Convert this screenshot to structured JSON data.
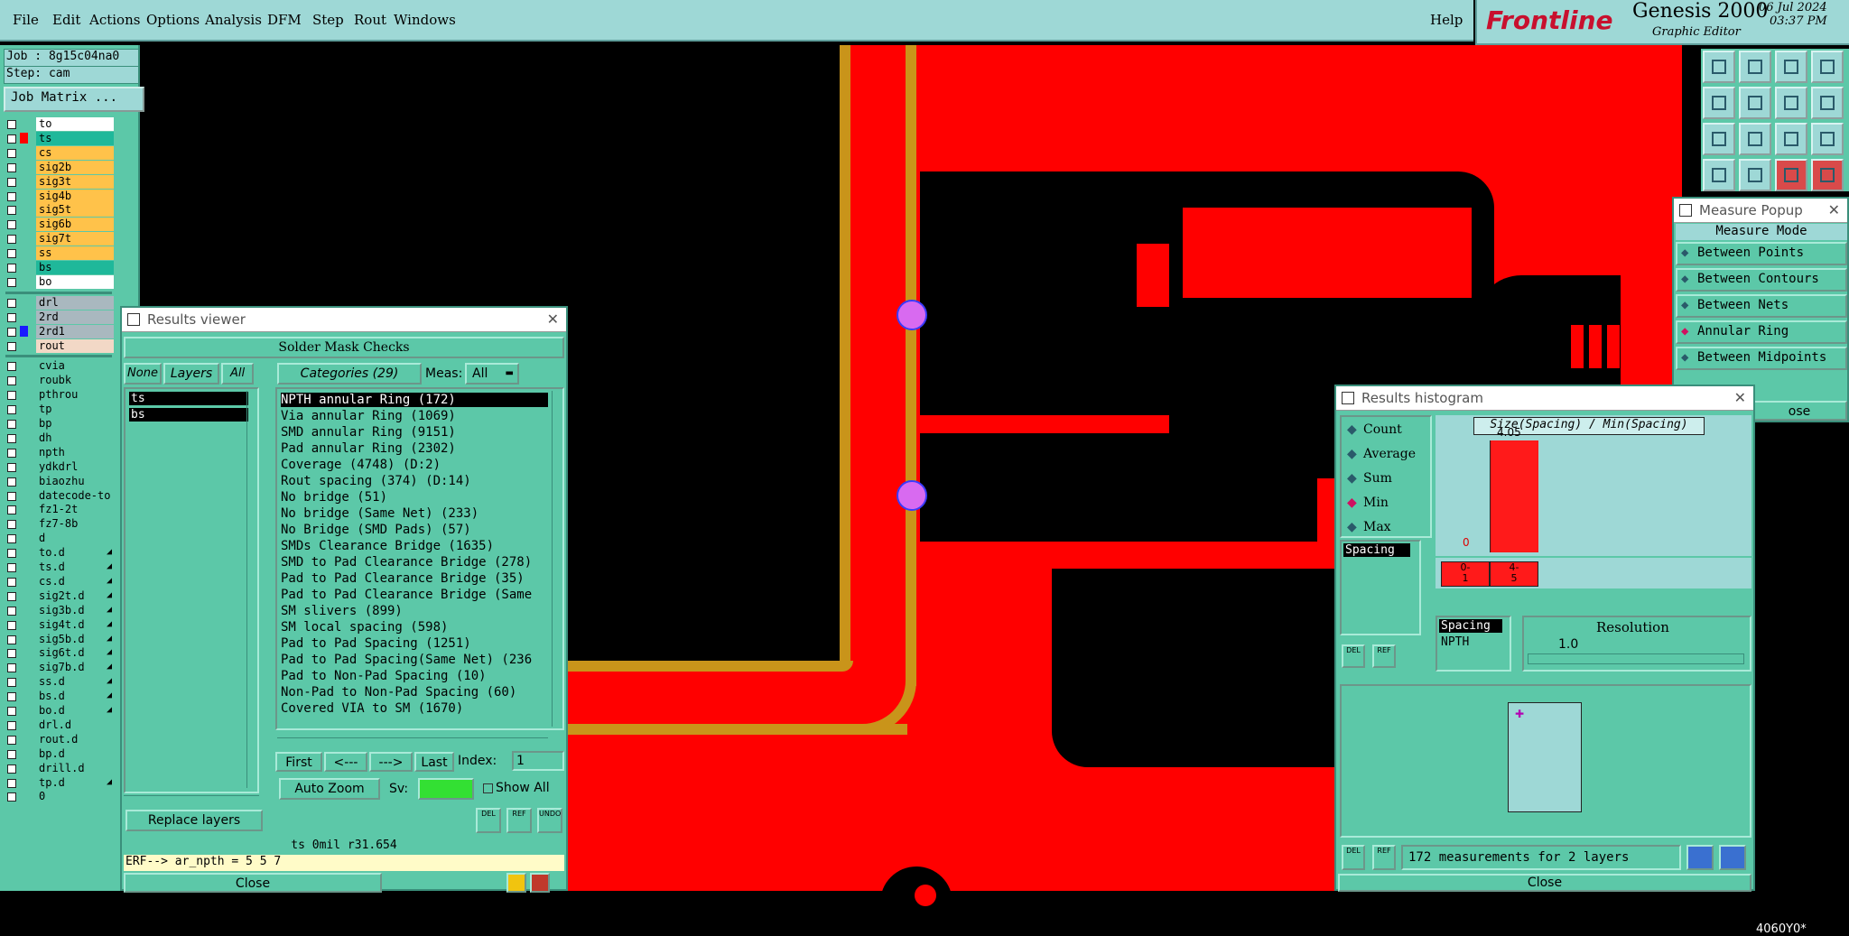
{
  "menu": [
    "File",
    "Edit",
    "Actions",
    "Options",
    "Analysis",
    "DFM",
    "Step",
    "Rout",
    "Windows"
  ],
  "help": "Help",
  "brand": {
    "logo": "Frontline",
    "product": "Genesis 2000",
    "subtitle": "Graphic Editor",
    "date": "06 Jul 2024",
    "time": "03:37 PM"
  },
  "job": {
    "job_line": "Job : 8g15c04na0",
    "step_line": "Step: cam",
    "matrix_button": "Job Matrix ..."
  },
  "layers_group1": [
    {
      "name": "to",
      "color": "#ffffff",
      "swatch": ""
    },
    {
      "name": "ts",
      "color": "#1fb89a",
      "swatch": "#ff0000"
    },
    {
      "name": "cs",
      "color": "#ffc24a",
      "swatch": ""
    },
    {
      "name": "sig2b",
      "color": "#ffc24a",
      "swatch": ""
    },
    {
      "name": "sig3t",
      "color": "#ffc24a",
      "swatch": ""
    },
    {
      "name": "sig4b",
      "color": "#ffc24a",
      "swatch": ""
    },
    {
      "name": "sig5t",
      "color": "#ffc24a",
      "swatch": ""
    },
    {
      "name": "sig6b",
      "color": "#ffc24a",
      "swatch": ""
    },
    {
      "name": "sig7t",
      "color": "#ffc24a",
      "swatch": ""
    },
    {
      "name": "ss",
      "color": "#ffc24a",
      "swatch": ""
    },
    {
      "name": "bs",
      "color": "#1fb89a",
      "swatch": ""
    },
    {
      "name": "bo",
      "color": "#ffffff",
      "swatch": ""
    }
  ],
  "layers_group2": [
    {
      "name": "drl",
      "color": "#a9b8bf",
      "swatch": ""
    },
    {
      "name": "2rd",
      "color": "#a9b8bf",
      "swatch": ""
    },
    {
      "name": "2rd1",
      "color": "#a9b8bf",
      "swatch": "#1a1aff"
    },
    {
      "name": "rout",
      "color": "#f2d8c6",
      "swatch": ""
    }
  ],
  "layers_group3": [
    "cvia",
    "roubk",
    "pthrou",
    "tp",
    "bp",
    "dh",
    "npth",
    "ydkdrl",
    "biaozhu",
    "datecode-to",
    "fz1-2t",
    "fz7-8b",
    "d",
    "to.d",
    "ts.d",
    "cs.d",
    "sig2t.d",
    "sig3b.d",
    "sig4t.d",
    "sig5b.d",
    "sig6t.d",
    "sig7b.d",
    "ss.d",
    "bs.d",
    "bo.d",
    "drl.d",
    "rout.d",
    "bp.d",
    "drill.d",
    "tp.d",
    "0"
  ],
  "results_viewer": {
    "title": "Results viewer",
    "header": "Solder Mask Checks",
    "btn_none": "None",
    "btn_layers": "Layers",
    "btn_all": "All",
    "categories_label": "Categories (29)",
    "meas_label": "Meas:",
    "meas_value": "All",
    "layers": [
      "ts",
      "bs"
    ],
    "categories": [
      "NPTH annular Ring (172)",
      "Via annular Ring (1069)",
      "SMD annular Ring (9151)",
      "Pad annular Ring (2302)",
      "Coverage (4748)          (D:2)",
      "Rout spacing (374)       (D:14)",
      "No bridge (51)",
      "No bridge (Same Net) (233)",
      "No Bridge (SMD Pads) (57)",
      "SMDs Clearance Bridge (1635)",
      "SMD to Pad Clearance Bridge (278)",
      "Pad to Pad Clearance Bridge (35)",
      "Pad to Pad Clearance Bridge (Same",
      "SM slivers (899)",
      "SM local spacing (598)",
      "Pad to Pad Spacing (1251)",
      "Pad to Pad Spacing(Same Net) (236",
      "Pad to Non-Pad Spacing (10)",
      "Non-Pad to Non-Pad Spacing (60)",
      "Covered VIA to SM (1670)"
    ],
    "nav_first": "First",
    "nav_prev": "<---",
    "nav_next": "--->",
    "nav_last": "Last",
    "index_label": "Index:",
    "index_value": "1",
    "auto_zoom": "Auto Zoom",
    "sv_label": "Sv:",
    "show_all": "Show All",
    "replace_layers": "Replace layers",
    "btn_del": "DEL",
    "btn_ref": "REF",
    "btn_undo": "UNDO",
    "status": "ts 0mil  r31.654",
    "erf": "ERF--> ar_npth = 5 5 7",
    "close": "Close"
  },
  "measure_popup": {
    "title": "Measure Popup",
    "mode_label": "Measure Mode",
    "modes": [
      "Between Points",
      "Between Contours",
      "Between Nets",
      "Annular Ring",
      "Between Midpoints"
    ],
    "selected": "Annular Ring",
    "close_partial": "ose"
  },
  "histogram": {
    "title": "Results histogram",
    "stats": [
      "Count",
      "Average",
      "Sum",
      "Min",
      "Max"
    ],
    "selected_stat": "Min",
    "chart_title": "Size(Spacing) / Min(Spacing)",
    "max_label": "4.05",
    "zero_label": "0",
    "bins": [
      "0-\n1",
      "4-\n5"
    ],
    "list_items": [
      "Spacing"
    ],
    "lower_list": [
      "Spacing",
      "NPTH"
    ],
    "resolution_label": "Resolution",
    "resolution_value": "1.0",
    "summary": "172 measurements for 2 layers",
    "btn_del": "DEL",
    "btn_ref": "REF",
    "close": "Close"
  },
  "chart_data": {
    "type": "bar",
    "title": "Size(Spacing) / Min(Spacing)",
    "categories": [
      "0-1",
      "4-5"
    ],
    "values": [
      0,
      4.05
    ]
  },
  "canvas_partial_text": "4060Y0*"
}
